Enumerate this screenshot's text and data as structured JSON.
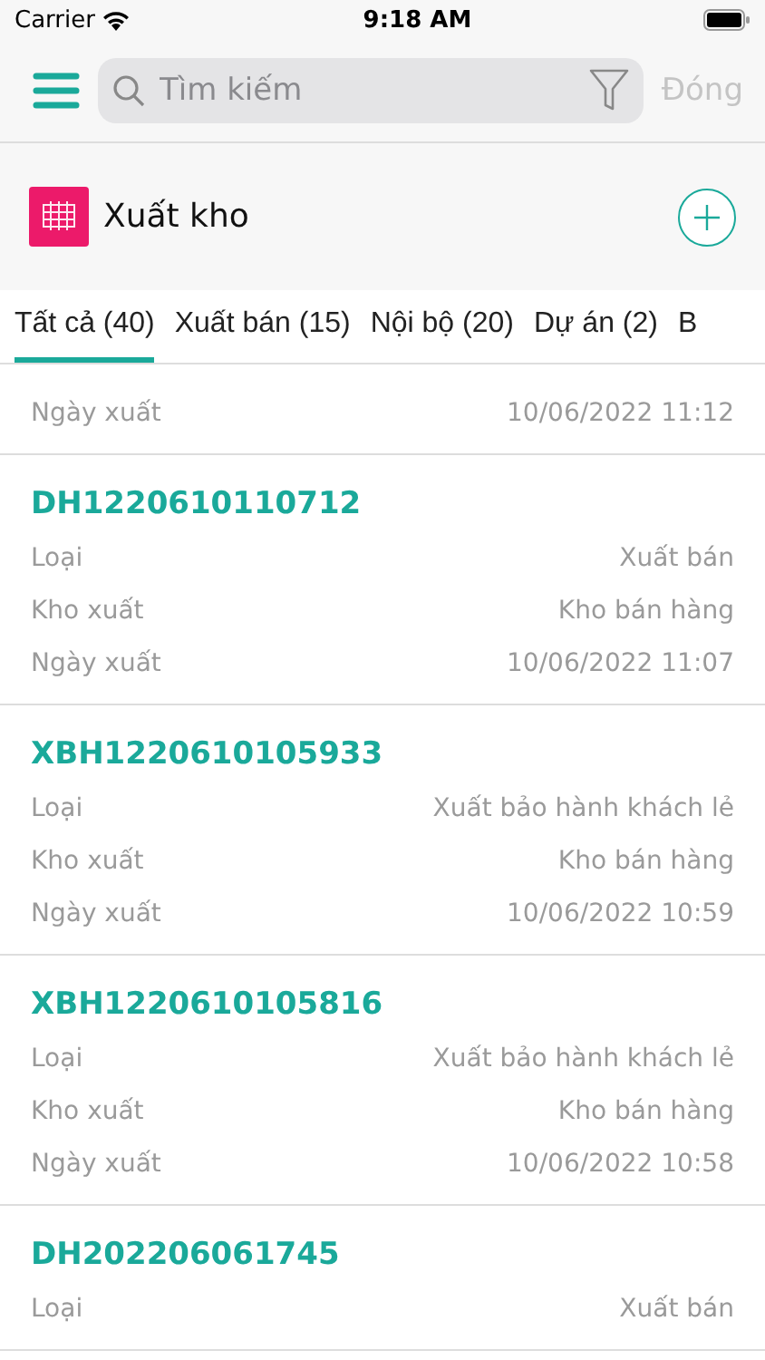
{
  "status_bar": {
    "carrier": "Carrier",
    "time": "9:18 AM"
  },
  "header": {
    "search": {
      "placeholder": "Tìm kiếm"
    },
    "close": "Đóng"
  },
  "section": {
    "title": "Xuất kho"
  },
  "tabs": [
    {
      "label": "Tất cả (40)",
      "selected": true
    },
    {
      "label": "Xuất bán (15)",
      "selected": false
    },
    {
      "label": "Nội bộ (20)",
      "selected": false
    },
    {
      "label": "Dự án (2)",
      "selected": false
    },
    {
      "label": "B",
      "selected": false
    }
  ],
  "orders": [
    {
      "rows": [
        {
          "label": "Ngày xuất",
          "value": "10/06/2022 11:12"
        }
      ]
    },
    {
      "code": "DH1220610110712",
      "rows": [
        {
          "label": "Loại",
          "value": "Xuất bán"
        },
        {
          "label": "Kho xuất",
          "value": "Kho bán hàng"
        },
        {
          "label": "Ngày xuất",
          "value": "10/06/2022 11:07"
        }
      ]
    },
    {
      "code": "XBH1220610105933",
      "rows": [
        {
          "label": "Loại",
          "value": "Xuất bảo hành khách lẻ"
        },
        {
          "label": "Kho xuất",
          "value": "Kho bán hàng"
        },
        {
          "label": "Ngày xuất",
          "value": "10/06/2022 10:59"
        }
      ]
    },
    {
      "code": "XBH1220610105816",
      "rows": [
        {
          "label": "Loại",
          "value": "Xuất bảo hành khách lẻ"
        },
        {
          "label": "Kho xuất",
          "value": "Kho bán hàng"
        },
        {
          "label": "Ngày xuất",
          "value": "10/06/2022 10:58"
        }
      ]
    },
    {
      "code": "DH202206061745",
      "rows": [
        {
          "label": "Loại",
          "value": "Xuất bán"
        }
      ]
    }
  ]
}
